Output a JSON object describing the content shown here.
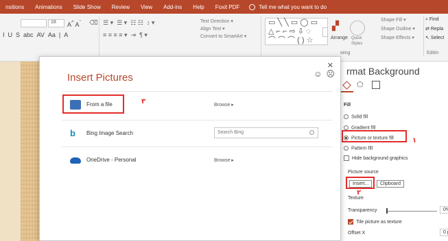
{
  "ribbon_tabs": [
    "nsitions",
    "Animations",
    "Slide Show",
    "Review",
    "View",
    "Add-ins",
    "Help",
    "Foxit PDF"
  ],
  "tell_me": "Tell me what you want to do",
  "ribbon": {
    "font_size": "18",
    "text_direction": "Text Direction",
    "align_text": "Align Text",
    "convert_smartart": "Convert to SmartArt",
    "arrange": "Arrange",
    "quick_styles": "Quick Styles",
    "shape_fill": "Shape Fill",
    "shape_outline": "Shape Outline",
    "shape_effects": "Shape Effects",
    "drawing_group": "wing",
    "find": "Find",
    "replace": "Repla",
    "select": "Select",
    "editing_group": "Editin"
  },
  "dialog": {
    "title": "Insert Pictures",
    "rows": [
      {
        "label": "From a file",
        "action": "Browse ▸",
        "annotation": "٣"
      },
      {
        "label": "Bing Image Search",
        "search_placeholder": "Search Bing"
      },
      {
        "label": "OneDrive - Personal",
        "action": "Browse ▸"
      }
    ]
  },
  "pane": {
    "title": "rmat Background",
    "fill_header": "Fill",
    "options": [
      "Solid fill",
      "Gradient fill",
      "Picture or texture fill",
      "Pattern fill"
    ],
    "hide_bg": "Hide background graphics",
    "picture_source": "Picture source",
    "insert_btn": "Insert...",
    "clipboard_btn": "Clipboard",
    "texture": "Texture",
    "transparency": "Transparency",
    "transparency_value": "0%",
    "tile": "Tile picture as texture",
    "offset_x": "Offset X",
    "offset_x_value": "0 p",
    "annotation_1": "١",
    "annotation_2": "٢"
  },
  "colors": {
    "accent": "#b7472a",
    "annotation": "#e32b2b"
  }
}
